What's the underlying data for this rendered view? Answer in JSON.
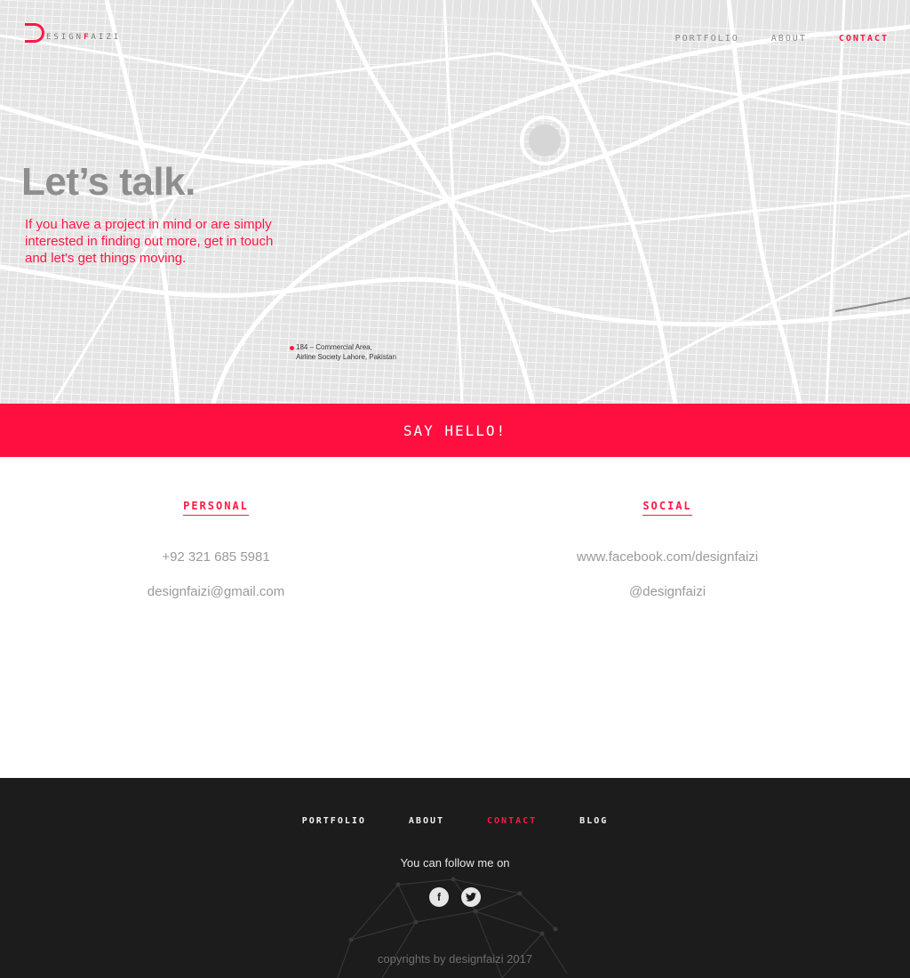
{
  "brand": {
    "prefix": "ESIGN",
    "accent": "F",
    "suffix": "AIZI",
    "mark_icon": "letter-d-logo"
  },
  "nav": {
    "items": [
      {
        "label": "PORTFOLIO",
        "active": false
      },
      {
        "label": "ABOUT",
        "active": false
      },
      {
        "label": "CONTACT",
        "active": true
      }
    ]
  },
  "hero": {
    "title": "Let’s talk.",
    "subtitle": "If you have a project in mind or are simply interested in finding out more, get in touch and let's get things moving.",
    "address_line1": "184 – Commercial Area,",
    "address_line2": "Airline Society Lahore, Pakistan"
  },
  "cta": {
    "label": "SAY HELLO!"
  },
  "personal": {
    "heading": "PERSONAL",
    "phone": "+92 321 685 5981",
    "email": "designfaizi@gmail.com"
  },
  "social": {
    "heading": "SOCIAL",
    "facebook": "www.facebook.com/designfaizi",
    "twitter": "@designfaizi"
  },
  "footer": {
    "nav": [
      {
        "label": "PORTFOLIO",
        "active": false
      },
      {
        "label": "ABOUT",
        "active": false
      },
      {
        "label": "CONTACT",
        "active": true
      },
      {
        "label": "BLOG",
        "active": false
      }
    ],
    "follow_text": "You can follow me on",
    "social_icons": [
      "facebook-icon",
      "twitter-icon"
    ],
    "copyright": "copyrights by designfaizi 2017"
  },
  "colors": {
    "accent": "#ff1744",
    "cta_bg": "#ff0f3f",
    "map_bg": "#e6e6e6",
    "footer_bg": "#1c1c1c"
  }
}
